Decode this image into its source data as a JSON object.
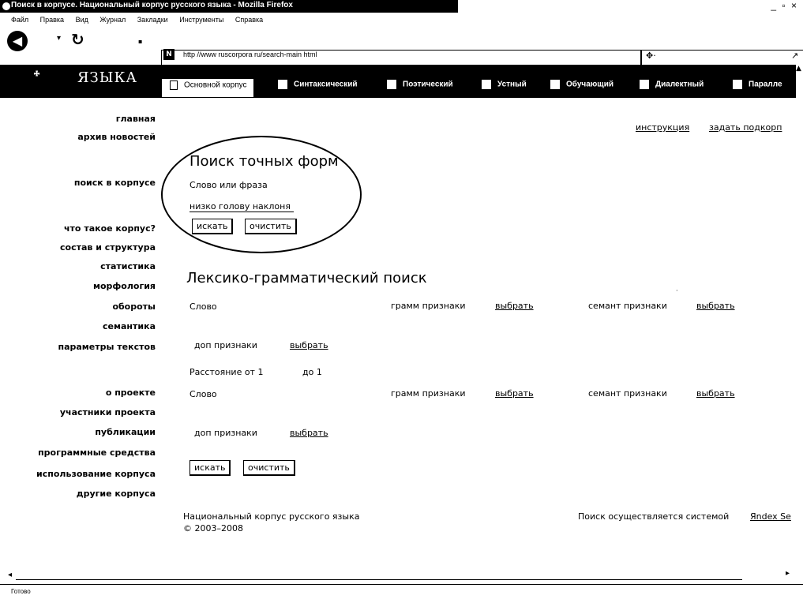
{
  "window": {
    "title": "Поиск в корпусе. Национальный корпус русского языка - Mozilla Firefox",
    "controls": "_ ▫ ×"
  },
  "menu": [
    "Файл",
    "Правка",
    "Вид",
    "Журнал",
    "Закладки",
    "Инструменты",
    "Справка"
  ],
  "toolbar": {
    "url": "http //www ruscorpora ru/search-main html",
    "url_icon": "N",
    "search_engine_glyph": "✥·",
    "search_go_glyph": "↗"
  },
  "site": {
    "logo": "ЯЗЫКА",
    "tabs": [
      {
        "label": "Основной корпус"
      },
      {
        "label": "Синтаксический"
      },
      {
        "label": "Поэтический"
      },
      {
        "label": "Устный"
      },
      {
        "label": "Обучающий"
      },
      {
        "label": "Диалектный"
      },
      {
        "label": "Паралле"
      }
    ]
  },
  "left_nav": {
    "group1": [
      "главная",
      "архив новостей"
    ],
    "group2": [
      "поиск в корпусе"
    ],
    "group3": [
      "что такое корпус?",
      "состав и структура",
      "статистика",
      "морфология",
      "обороты",
      "семантика",
      "параметры текстов"
    ],
    "group4": [
      "о проекте",
      "участники проекта",
      "публикации",
      "программные средства",
      "использование корпуса",
      "другие корпуса"
    ]
  },
  "top_links": {
    "instruction": "инструкция",
    "subcorpus": "задать подкорп"
  },
  "exact_search": {
    "title": "Поиск точных форм",
    "label": "Слово или фраза",
    "value": "низко голову наклоня",
    "search_btn": "искать",
    "clear_btn": "очистить"
  },
  "lexgram": {
    "title": "Лексико-грамматический поиск",
    "word": "Слово",
    "gram": "грамм признаки",
    "select": "выбрать",
    "sem": "семант признаки",
    "extra": "доп признаки",
    "distance_from": "Расстояние от 1",
    "distance_to": "до 1",
    "search_btn": "искать",
    "clear_btn": "очистить"
  },
  "footer": {
    "name": "Национальный корпус русского языка",
    "years": "© 2003–2008",
    "engine_text": "Поиск осуществляется системой",
    "engine_link": "Яndex Se"
  },
  "status": "Готово"
}
